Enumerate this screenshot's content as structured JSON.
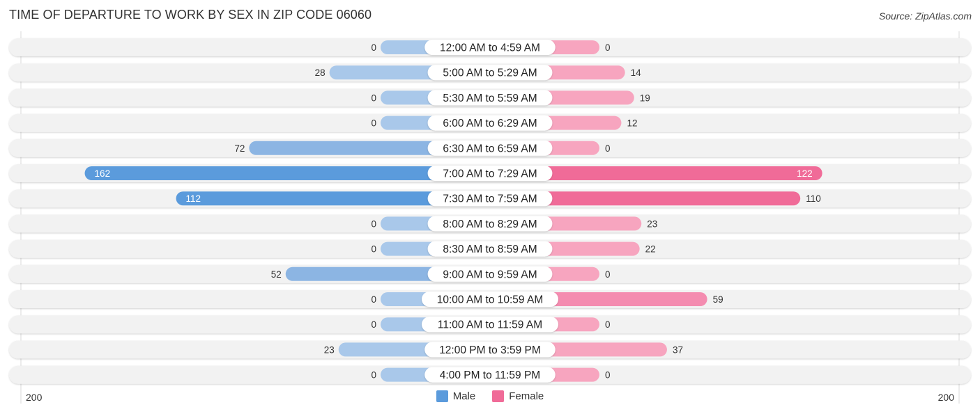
{
  "header": {
    "title": "TIME OF DEPARTURE TO WORK BY SEX IN ZIP CODE 06060",
    "source": "Source: ZipAtlas.com"
  },
  "colors": {
    "male_strong": "#5b9bdc",
    "male_light": "#a9c8ea",
    "female_strong": "#f06b98",
    "female_light": "#f7a5bf",
    "row_bg": "#f2f2f2"
  },
  "chart_data": {
    "type": "bar",
    "orientation": "horizontal-diverging",
    "title": "TIME OF DEPARTURE TO WORK BY SEX IN ZIP CODE 06060",
    "categories": [
      "12:00 AM to 4:59 AM",
      "5:00 AM to 5:29 AM",
      "5:30 AM to 5:59 AM",
      "6:00 AM to 6:29 AM",
      "6:30 AM to 6:59 AM",
      "7:00 AM to 7:29 AM",
      "7:30 AM to 7:59 AM",
      "8:00 AM to 8:29 AM",
      "8:30 AM to 8:59 AM",
      "9:00 AM to 9:59 AM",
      "10:00 AM to 10:59 AM",
      "11:00 AM to 11:59 AM",
      "12:00 PM to 3:59 PM",
      "4:00 PM to 11:59 PM"
    ],
    "series": [
      {
        "name": "Male",
        "side": "left",
        "values": [
          0,
          28,
          0,
          0,
          72,
          162,
          112,
          0,
          0,
          52,
          0,
          0,
          23,
          0
        ]
      },
      {
        "name": "Female",
        "side": "right",
        "values": [
          0,
          14,
          19,
          12,
          0,
          122,
          110,
          23,
          22,
          0,
          59,
          0,
          37,
          0
        ]
      }
    ],
    "axis": {
      "left_label": "200",
      "right_label": "200",
      "range": [
        0,
        200
      ]
    },
    "legend": {
      "position": "bottom-center",
      "items": [
        "Male",
        "Female"
      ]
    },
    "grid": false
  }
}
